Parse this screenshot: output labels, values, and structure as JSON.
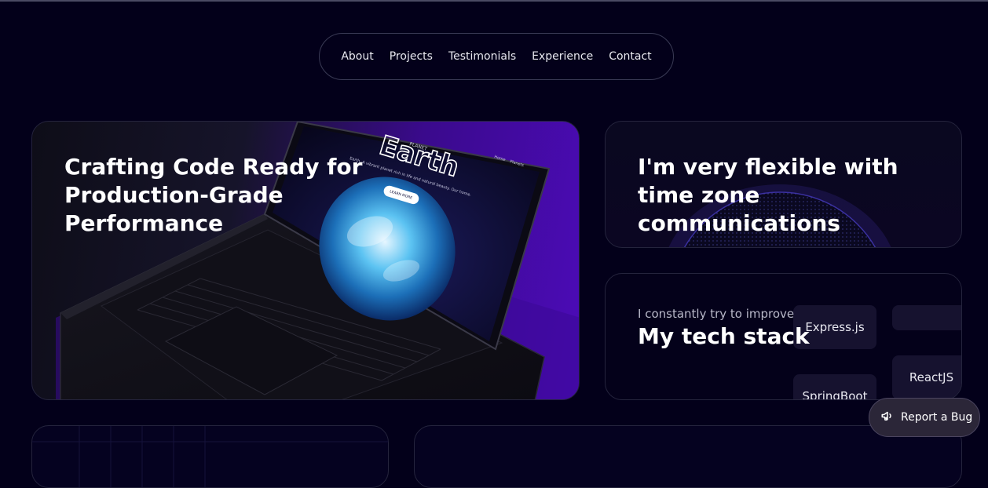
{
  "nav": {
    "items": [
      "About",
      "Projects",
      "Testimonials",
      "Experience",
      "Contact"
    ]
  },
  "hero": {
    "title": "Crafting Code Ready for Production-Grade Performance",
    "screen": {
      "brand_small": "PLANET",
      "brand_big": "Earth",
      "tagline": "Earth. A vibrant planet rich in life and natural beauty. Our home.",
      "button": "LEARN MORE",
      "nav_home": "Home",
      "nav_planets": "Planets"
    }
  },
  "timezone": {
    "title": "I'm very flexible with time zone communications"
  },
  "stack": {
    "subtitle": "I constantly try to improve",
    "title": "My tech stack",
    "chips": [
      "Express.js",
      "",
      "ReactJS",
      "SpringBoot"
    ]
  },
  "report_bug": {
    "label": "Report a Bug",
    "icon": "megaphone-icon"
  },
  "colors": {
    "background": "#03001a",
    "accent_purple": "#4c0bb8",
    "card_border": "#25243d"
  }
}
